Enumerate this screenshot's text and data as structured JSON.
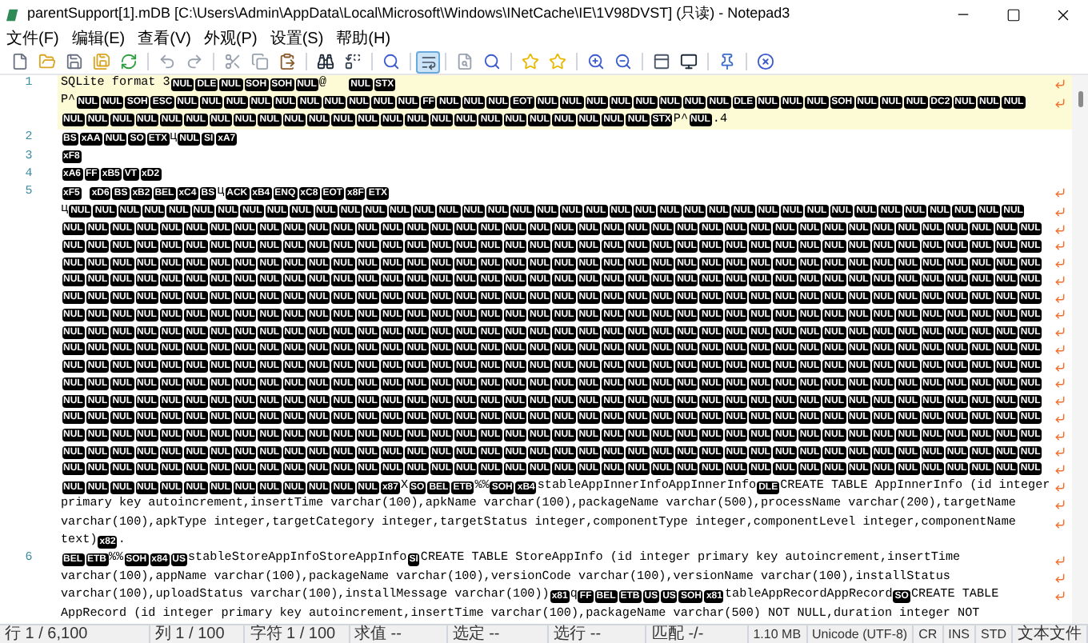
{
  "window": {
    "title": "parentSupport[1].mDB [C:\\Users\\Admin\\AppData\\Local\\Microsoft\\Windows\\INetCache\\IE\\1V98DVST] (只读) - Notepad3"
  },
  "menu": [
    "文件(F)",
    "编辑(E)",
    "查看(V)",
    "外观(P)",
    "设置(S)",
    "帮助(H)"
  ],
  "toolbar": {
    "word_wrap": {
      "selected": true
    }
  },
  "lines": [
    {
      "number": "1",
      "current": true,
      "rows": [
        {
          "segments": [
            {
              "kind": "text",
              "text": "SQLite format 3"
            },
            {
              "kind": "ctrl",
              "texts": [
                "NUL",
                "DLE",
                "NUL",
                "SOH",
                "SOH",
                "NUL"
              ]
            },
            {
              "kind": "text",
              "text": "@   "
            },
            {
              "kind": "ctrl",
              "texts": [
                "NUL",
                "STX"
              ]
            }
          ]
        },
        {
          "segments": [
            {
              "kind": "text",
              "text": "P^"
            },
            {
              "kind": "ctrl",
              "texts": [
                "NUL",
                "NUL",
                "SOH",
                "ESC",
                "NUL",
                "NUL",
                "NUL",
                "NUL",
                "NUL",
                "NUL",
                "NUL",
                "NUL",
                "NUL",
                "NUL",
                "FF",
                "NUL",
                "NUL",
                "NUL",
                "EOT",
                "NUL",
                "NUL",
                "NUL",
                "NUL",
                "NUL",
                "NUL",
                "NUL",
                "NUL",
                "DLE",
                "NUL",
                "NUL",
                "NUL",
                "SOH",
                "NUL",
                "NUL",
                "NUL",
                "DC2",
                "NUL",
                "NUL",
                "NUL"
              ]
            }
          ]
        },
        {
          "segments": [
            {
              "kind": "ctrl",
              "texts": [
                "NUL",
                "NUL",
                "NUL",
                "NUL",
                "NUL",
                "NUL",
                "NUL",
                "NUL",
                "NUL",
                "NUL",
                "NUL",
                "NUL",
                "NUL",
                "NUL",
                "NUL",
                "NUL",
                "NUL",
                "NUL",
                "NUL",
                "NUL",
                "NUL",
                "NUL",
                "NUL",
                "NUL",
                "STX"
              ]
            },
            {
              "kind": "text",
              "text": "P^"
            },
            {
              "kind": "ctrl",
              "texts": [
                "NUL"
              ]
            },
            {
              "kind": "text",
              "text": ".4"
            }
          ]
        }
      ]
    },
    {
      "number": "2",
      "current": false,
      "rows": [
        {
          "segments": [
            {
              "kind": "ctrl",
              "texts": [
                "BS",
                "xAA",
                "NUL",
                "SO",
                "ETX"
              ]
            },
            {
              "kind": "text",
              "text": "ц"
            },
            {
              "kind": "ctrl",
              "texts": [
                "NUL",
                "SI",
                "xA7"
              ]
            }
          ]
        }
      ]
    },
    {
      "number": "3",
      "current": false,
      "rows": [
        {
          "segments": [
            {
              "kind": "ctrl",
              "texts": [
                "xF8"
              ]
            }
          ]
        }
      ]
    },
    {
      "number": "4",
      "current": false,
      "rows": [
        {
          "segments": [
            {
              "kind": "ctrl",
              "texts": [
                "xA6",
                "FF",
                "xB5",
                "VT",
                "xD2"
              ]
            }
          ]
        }
      ]
    },
    {
      "number": "5",
      "current": false,
      "rows": [
        {
          "segments": [
            {
              "kind": "ctrl",
              "texts": [
                "xF5"
              ]
            },
            {
              "kind": "gap"
            },
            {
              "kind": "ctrl",
              "texts": [
                "xD6",
                "BS",
                "xB2",
                "BEL",
                "xC4",
                "BS"
              ]
            },
            {
              "kind": "text",
              "text": "ц"
            },
            {
              "kind": "ctrl",
              "texts": [
                "ACK",
                "xB4",
                "ENQ",
                "xC8",
                "EOT",
                "x8F",
                "ETX"
              ]
            }
          ]
        },
        {
          "segments": [
            {
              "kind": "text",
              "text": "ц"
            },
            {
              "kind": "ctrl",
              "texts": [
                "NUL",
                "NUL",
                "NUL",
                "NUL",
                "NUL",
                "NUL",
                "NUL",
                "NUL",
                "NUL",
                "NUL",
                "NUL",
                "NUL",
                "NUL",
                "NUL",
                "NUL",
                "NUL",
                "NUL",
                "NUL",
                "NUL",
                "NUL",
                "NUL",
                "NUL",
                "NUL",
                "NUL",
                "NUL",
                "NUL",
                "NUL",
                "NUL",
                "NUL",
                "NUL",
                "NUL",
                "NUL",
                "NUL",
                "NUL",
                "NUL",
                "NUL",
                "NUL",
                "NUL",
                "NUL"
              ]
            }
          ]
        },
        {
          "segments": [
            {
              "kind": "ctrl",
              "texts": [
                "NUL",
                "NUL",
                "NUL",
                "NUL",
                "NUL",
                "NUL",
                "NUL",
                "NUL",
                "NUL",
                "NUL",
                "NUL",
                "NUL",
                "NUL",
                "NUL",
                "NUL",
                "NUL",
                "NUL",
                "NUL",
                "NUL",
                "NUL",
                "NUL",
                "NUL",
                "NUL",
                "NUL",
                "NUL",
                "NUL",
                "NUL",
                "NUL",
                "NUL",
                "NUL",
                "NUL",
                "NUL",
                "NUL",
                "NUL",
                "NUL",
                "NUL",
                "NUL",
                "NUL",
                "NUL",
                "NUL"
              ]
            }
          ]
        },
        {
          "segments": [
            {
              "kind": "ctrl",
              "texts": [
                "NUL",
                "NUL",
                "NUL",
                "NUL",
                "NUL",
                "NUL",
                "NUL",
                "NUL",
                "NUL",
                "NUL",
                "NUL",
                "NUL",
                "NUL",
                "NUL",
                "NUL",
                "NUL",
                "NUL",
                "NUL",
                "NUL",
                "NUL",
                "NUL",
                "NUL",
                "NUL",
                "NUL",
                "NUL",
                "NUL",
                "NUL",
                "NUL",
                "NUL",
                "NUL",
                "NUL",
                "NUL",
                "NUL",
                "NUL",
                "NUL",
                "NUL",
                "NUL",
                "NUL",
                "NUL",
                "NUL"
              ]
            }
          ]
        },
        {
          "segments": [
            {
              "kind": "ctrl",
              "texts": [
                "NUL",
                "NUL",
                "NUL",
                "NUL",
                "NUL",
                "NUL",
                "NUL",
                "NUL",
                "NUL",
                "NUL",
                "NUL",
                "NUL",
                "NUL",
                "NUL",
                "NUL",
                "NUL",
                "NUL",
                "NUL",
                "NUL",
                "NUL",
                "NUL",
                "NUL",
                "NUL",
                "NUL",
                "NUL",
                "NUL",
                "NUL",
                "NUL",
                "NUL",
                "NUL",
                "NUL",
                "NUL",
                "NUL",
                "NUL",
                "NUL",
                "NUL",
                "NUL",
                "NUL",
                "NUL",
                "NUL"
              ]
            }
          ]
        },
        {
          "segments": [
            {
              "kind": "ctrl",
              "texts": [
                "NUL",
                "NUL",
                "NUL",
                "NUL",
                "NUL",
                "NUL",
                "NUL",
                "NUL",
                "NUL",
                "NUL",
                "NUL",
                "NUL",
                "NUL",
                "NUL",
                "NUL",
                "NUL",
                "NUL",
                "NUL",
                "NUL",
                "NUL",
                "NUL",
                "NUL",
                "NUL",
                "NUL",
                "NUL",
                "NUL",
                "NUL",
                "NUL",
                "NUL",
                "NUL",
                "NUL",
                "NUL",
                "NUL",
                "NUL",
                "NUL",
                "NUL",
                "NUL",
                "NUL",
                "NUL",
                "NUL"
              ]
            }
          ]
        },
        {
          "segments": [
            {
              "kind": "ctrl",
              "texts": [
                "NUL",
                "NUL",
                "NUL",
                "NUL",
                "NUL",
                "NUL",
                "NUL",
                "NUL",
                "NUL",
                "NUL",
                "NUL",
                "NUL",
                "NUL",
                "NUL",
                "NUL",
                "NUL",
                "NUL",
                "NUL",
                "NUL",
                "NUL",
                "NUL",
                "NUL",
                "NUL",
                "NUL",
                "NUL",
                "NUL",
                "NUL",
                "NUL",
                "NUL",
                "NUL",
                "NUL",
                "NUL",
                "NUL",
                "NUL",
                "NUL",
                "NUL",
                "NUL",
                "NUL",
                "NUL",
                "NUL"
              ]
            }
          ]
        },
        {
          "segments": [
            {
              "kind": "ctrl",
              "texts": [
                "NUL",
                "NUL",
                "NUL",
                "NUL",
                "NUL",
                "NUL",
                "NUL",
                "NUL",
                "NUL",
                "NUL",
                "NUL",
                "NUL",
                "NUL",
                "NUL",
                "NUL",
                "NUL",
                "NUL",
                "NUL",
                "NUL",
                "NUL",
                "NUL",
                "NUL",
                "NUL",
                "NUL",
                "NUL",
                "NUL",
                "NUL",
                "NUL",
                "NUL",
                "NUL",
                "NUL",
                "NUL",
                "NUL",
                "NUL",
                "NUL",
                "NUL",
                "NUL",
                "NUL",
                "NUL",
                "NUL"
              ]
            }
          ]
        },
        {
          "segments": [
            {
              "kind": "ctrl",
              "texts": [
                "NUL",
                "NUL",
                "NUL",
                "NUL",
                "NUL",
                "NUL",
                "NUL",
                "NUL",
                "NUL",
                "NUL",
                "NUL",
                "NUL",
                "NUL",
                "NUL",
                "NUL",
                "NUL",
                "NUL",
                "NUL",
                "NUL",
                "NUL",
                "NUL",
                "NUL",
                "NUL",
                "NUL",
                "NUL",
                "NUL",
                "NUL",
                "NUL",
                "NUL",
                "NUL",
                "NUL",
                "NUL",
                "NUL",
                "NUL",
                "NUL",
                "NUL",
                "NUL",
                "NUL",
                "NUL",
                "NUL"
              ]
            }
          ]
        },
        {
          "segments": [
            {
              "kind": "ctrl",
              "texts": [
                "NUL",
                "NUL",
                "NUL",
                "NUL",
                "NUL",
                "NUL",
                "NUL",
                "NUL",
                "NUL",
                "NUL",
                "NUL",
                "NUL",
                "NUL",
                "NUL",
                "NUL",
                "NUL",
                "NUL",
                "NUL",
                "NUL",
                "NUL",
                "NUL",
                "NUL",
                "NUL",
                "NUL",
                "NUL",
                "NUL",
                "NUL",
                "NUL",
                "NUL",
                "NUL",
                "NUL",
                "NUL",
                "NUL",
                "NUL",
                "NUL",
                "NUL",
                "NUL",
                "NUL",
                "NUL",
                "NUL"
              ]
            }
          ]
        },
        {
          "segments": [
            {
              "kind": "ctrl",
              "texts": [
                "NUL",
                "NUL",
                "NUL",
                "NUL",
                "NUL",
                "NUL",
                "NUL",
                "NUL",
                "NUL",
                "NUL",
                "NUL",
                "NUL",
                "NUL",
                "NUL",
                "NUL",
                "NUL",
                "NUL",
                "NUL",
                "NUL",
                "NUL",
                "NUL",
                "NUL",
                "NUL",
                "NUL",
                "NUL",
                "NUL",
                "NUL",
                "NUL",
                "NUL",
                "NUL",
                "NUL",
                "NUL",
                "NUL",
                "NUL",
                "NUL",
                "NUL",
                "NUL",
                "NUL",
                "NUL",
                "NUL"
              ]
            }
          ]
        },
        {
          "segments": [
            {
              "kind": "ctrl",
              "texts": [
                "NUL",
                "NUL",
                "NUL",
                "NUL",
                "NUL",
                "NUL",
                "NUL",
                "NUL",
                "NUL",
                "NUL",
                "NUL",
                "NUL",
                "NUL",
                "NUL",
                "NUL",
                "NUL",
                "NUL",
                "NUL",
                "NUL",
                "NUL",
                "NUL",
                "NUL",
                "NUL",
                "NUL",
                "NUL",
                "NUL",
                "NUL",
                "NUL",
                "NUL",
                "NUL",
                "NUL",
                "NUL",
                "NUL",
                "NUL",
                "NUL",
                "NUL",
                "NUL",
                "NUL",
                "NUL",
                "NUL"
              ]
            }
          ]
        },
        {
          "segments": [
            {
              "kind": "ctrl",
              "texts": [
                "NUL",
                "NUL",
                "NUL",
                "NUL",
                "NUL",
                "NUL",
                "NUL",
                "NUL",
                "NUL",
                "NUL",
                "NUL",
                "NUL",
                "NUL",
                "NUL",
                "NUL",
                "NUL",
                "NUL",
                "NUL",
                "NUL",
                "NUL",
                "NUL",
                "NUL",
                "NUL",
                "NUL",
                "NUL",
                "NUL",
                "NUL",
                "NUL",
                "NUL",
                "NUL",
                "NUL",
                "NUL",
                "NUL",
                "NUL",
                "NUL",
                "NUL",
                "NUL",
                "NUL",
                "NUL",
                "NUL"
              ]
            }
          ]
        },
        {
          "segments": [
            {
              "kind": "ctrl",
              "texts": [
                "NUL",
                "NUL",
                "NUL",
                "NUL",
                "NUL",
                "NUL",
                "NUL",
                "NUL",
                "NUL",
                "NUL",
                "NUL",
                "NUL",
                "NUL",
                "NUL",
                "NUL",
                "NUL",
                "NUL",
                "NUL",
                "NUL",
                "NUL",
                "NUL",
                "NUL",
                "NUL",
                "NUL",
                "NUL",
                "NUL",
                "NUL",
                "NUL",
                "NUL",
                "NUL",
                "NUL",
                "NUL",
                "NUL",
                "NUL",
                "NUL",
                "NUL",
                "NUL",
                "NUL",
                "NUL",
                "NUL"
              ]
            }
          ]
        },
        {
          "segments": [
            {
              "kind": "ctrl",
              "texts": [
                "NUL",
                "NUL",
                "NUL",
                "NUL",
                "NUL",
                "NUL",
                "NUL",
                "NUL",
                "NUL",
                "NUL",
                "NUL",
                "NUL",
                "NUL",
                "NUL",
                "NUL",
                "NUL",
                "NUL",
                "NUL",
                "NUL",
                "NUL",
                "NUL",
                "NUL",
                "NUL",
                "NUL",
                "NUL",
                "NUL",
                "NUL",
                "NUL",
                "NUL",
                "NUL",
                "NUL",
                "NUL",
                "NUL",
                "NUL",
                "NUL",
                "NUL",
                "NUL",
                "NUL",
                "NUL",
                "NUL"
              ]
            }
          ]
        },
        {
          "segments": [
            {
              "kind": "ctrl",
              "texts": [
                "NUL",
                "NUL",
                "NUL",
                "NUL",
                "NUL",
                "NUL",
                "NUL",
                "NUL",
                "NUL",
                "NUL",
                "NUL",
                "NUL",
                "NUL",
                "NUL",
                "NUL",
                "NUL",
                "NUL",
                "NUL",
                "NUL",
                "NUL",
                "NUL",
                "NUL",
                "NUL",
                "NUL",
                "NUL",
                "NUL",
                "NUL",
                "NUL",
                "NUL",
                "NUL",
                "NUL",
                "NUL",
                "NUL",
                "NUL",
                "NUL",
                "NUL",
                "NUL",
                "NUL",
                "NUL",
                "NUL"
              ]
            }
          ]
        },
        {
          "segments": [
            {
              "kind": "ctrl",
              "texts": [
                "NUL",
                "NUL",
                "NUL",
                "NUL",
                "NUL",
                "NUL",
                "NUL",
                "NUL",
                "NUL",
                "NUL",
                "NUL",
                "NUL",
                "NUL",
                "NUL",
                "NUL",
                "NUL",
                "NUL",
                "NUL",
                "NUL",
                "NUL",
                "NUL",
                "NUL",
                "NUL",
                "NUL",
                "NUL",
                "NUL",
                "NUL",
                "NUL",
                "NUL",
                "NUL",
                "NUL",
                "NUL",
                "NUL",
                "NUL",
                "NUL",
                "NUL",
                "NUL",
                "NUL",
                "NUL",
                "NUL"
              ]
            }
          ]
        },
        {
          "segments": [
            {
              "kind": "ctrl",
              "texts": [
                "NUL",
                "NUL",
                "NUL",
                "NUL",
                "NUL",
                "NUL",
                "NUL",
                "NUL",
                "NUL",
                "NUL",
                "NUL",
                "NUL",
                "NUL",
                "x87"
              ]
            },
            {
              "kind": "text",
              "text": "X"
            },
            {
              "kind": "ctrl",
              "texts": [
                "SO",
                "BEL",
                "ETB"
              ]
            },
            {
              "kind": "text",
              "text": "%%"
            },
            {
              "kind": "ctrl",
              "texts": [
                "SOH",
                "xB4"
              ]
            },
            {
              "kind": "text",
              "text": "stableAppInnerInfoAppInnerInfo"
            },
            {
              "kind": "ctrl",
              "texts": [
                "DLE"
              ]
            },
            {
              "kind": "text",
              "text": "CREATE TABLE AppInnerInfo (id integer"
            }
          ]
        },
        {
          "segments": [
            {
              "kind": "text",
              "text": "primary key autoincrement,insertTime varchar(100),apkName varchar(100),packageName varchar(500),processName varchar(200),targetName"
            }
          ]
        },
        {
          "segments": [
            {
              "kind": "text",
              "text": "varchar(100),apkType integer,targetCategory integer,targetStatus integer,componentType integer,componentLevel integer,componentName"
            }
          ]
        },
        {
          "segments": [
            {
              "kind": "text",
              "text": "text)"
            },
            {
              "kind": "ctrl",
              "texts": [
                "x82"
              ]
            },
            {
              "kind": "text",
              "text": "."
            }
          ]
        }
      ]
    },
    {
      "number": "6",
      "current": false,
      "rows": [
        {
          "segments": [
            {
              "kind": "ctrl",
              "texts": [
                "BEL",
                "ETB"
              ]
            },
            {
              "kind": "text",
              "text": "%%"
            },
            {
              "kind": "ctrl",
              "texts": [
                "SOH",
                "x84",
                "US"
              ]
            },
            {
              "kind": "text",
              "text": "stableStoreAppInfoStoreAppInfo"
            },
            {
              "kind": "ctrl",
              "texts": [
                "SI"
              ]
            },
            {
              "kind": "text",
              "text": "CREATE TABLE StoreAppInfo (id integer primary key autoincrement,insertTime"
            }
          ]
        },
        {
          "segments": [
            {
              "kind": "text",
              "text": "varchar(100),appName varchar(100),packageName varchar(100),versionCode varchar(100),versionName varchar(100),installStatus"
            }
          ]
        },
        {
          "segments": [
            {
              "kind": "text",
              "text": "varchar(100),uploadStatus varchar(100),installMessage varchar(100))"
            },
            {
              "kind": "ctrl",
              "texts": [
                "x81"
              ]
            },
            {
              "kind": "text",
              "text": "q"
            },
            {
              "kind": "ctrl",
              "texts": [
                "FF",
                "BEL",
                "ETB",
                "US",
                "US",
                "SOH",
                "x81"
              ]
            },
            {
              "kind": "text",
              "text": "tableAppRecordAppRecord"
            },
            {
              "kind": "ctrl",
              "texts": [
                "SO"
              ]
            },
            {
              "kind": "text",
              "text": "CREATE TABLE"
            }
          ]
        },
        {
          "segments": [
            {
              "kind": "text",
              "text": "AppRecord (id integer primary key autoincrement,insertTime varchar(100),packageName varchar(500) NOT NULL,duration integer NOT"
            }
          ]
        }
      ]
    }
  ],
  "status_bar": [
    "行 1 / 6,100",
    "列 1 / 100",
    "字符 1 / 100",
    "求值 --",
    "选定 --",
    "选行 --",
    "匹配 -/-",
    "1.10 MB",
    "Unicode (UTF-8)",
    "CR",
    "INS",
    "STD",
    "文本文件"
  ]
}
